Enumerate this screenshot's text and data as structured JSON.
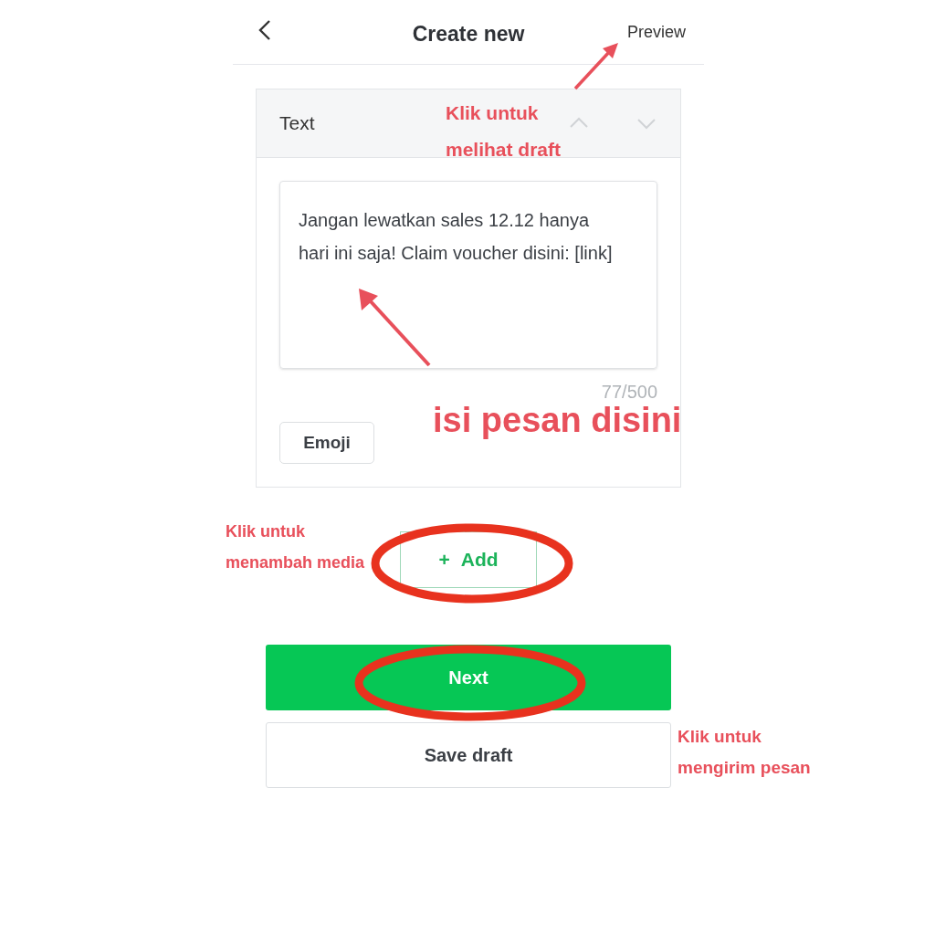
{
  "header": {
    "title": "Create new",
    "action": "Preview"
  },
  "section": {
    "title": "Text",
    "message": "Jangan lewatkan sales 12.12 hanya hari ini saja! Claim voucher disini: [link]",
    "counter": "77/500",
    "emoji_button": "Emoji"
  },
  "add_button": "+ Add",
  "buttons": {
    "next": "Next",
    "save_draft": "Save draft"
  },
  "annotations": [
    {
      "lines": [
        "Klik untuk",
        "melihat draft"
      ]
    },
    {
      "lines": [
        "isi pesan disini"
      ]
    },
    {
      "lines": [
        "Klik untuk",
        "menambah media"
      ]
    },
    {
      "lines": [
        "Klik untuk",
        "mengirim pesan"
      ]
    }
  ]
}
